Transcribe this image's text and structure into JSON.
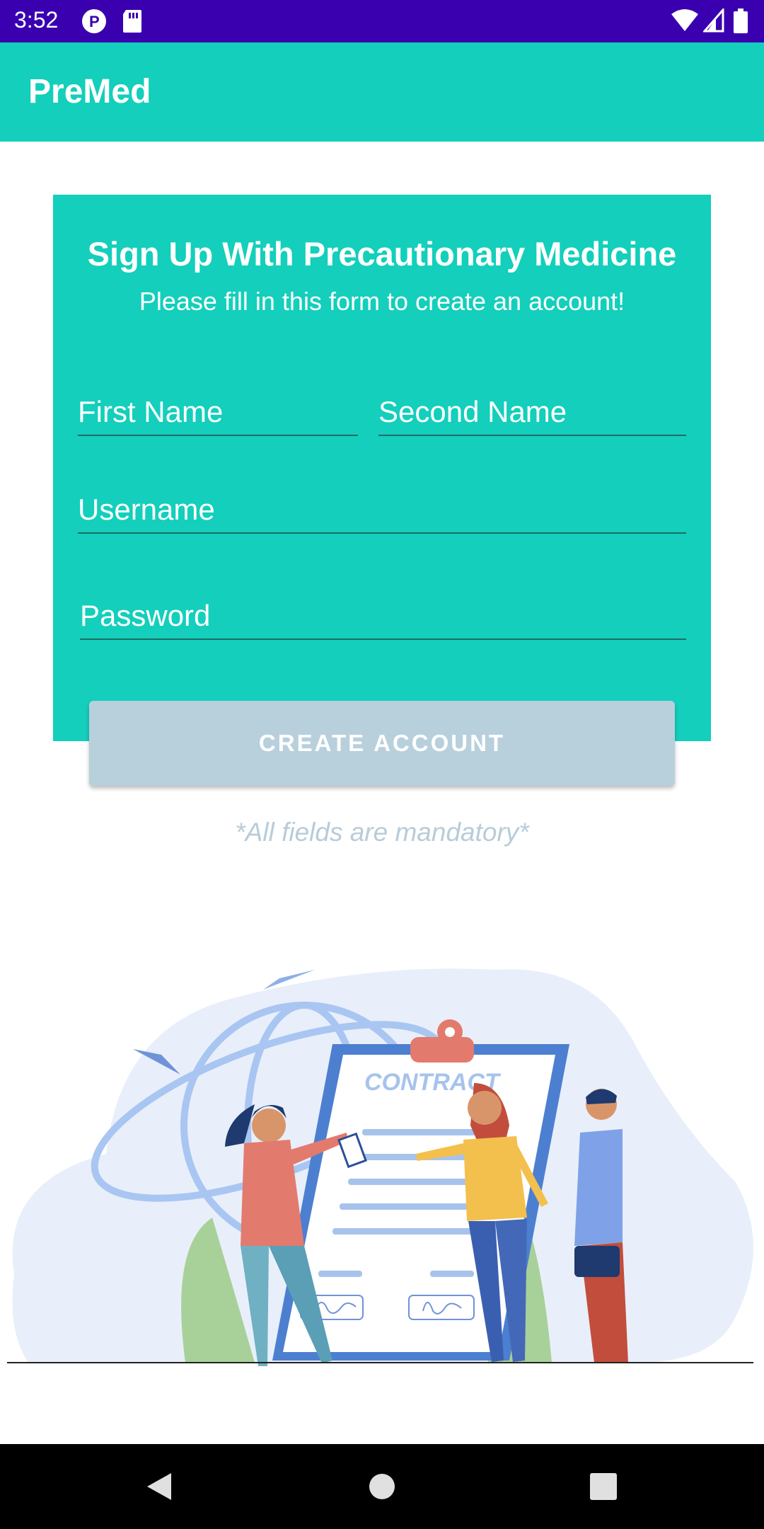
{
  "status_bar": {
    "time": "3:52"
  },
  "app_bar": {
    "title": "PreMed"
  },
  "form": {
    "title": "Sign Up With Precautionary Medicine",
    "subtitle": "Please fill in this form to create an account!",
    "first_name_placeholder": "First Name",
    "second_name_placeholder": "Second Name",
    "username_placeholder": "Username",
    "password_placeholder": "Password",
    "submit_label": "CREATE ACCOUNT",
    "mandatory_note": "*All fields are mandatory*"
  },
  "illustration": {
    "contract_text": "CONTRACT"
  },
  "colors": {
    "status_bar": "#3a00b0",
    "primary": "#13cfbb",
    "button_disabled": "#b8d0dc",
    "note_text": "#b8ccd8"
  }
}
